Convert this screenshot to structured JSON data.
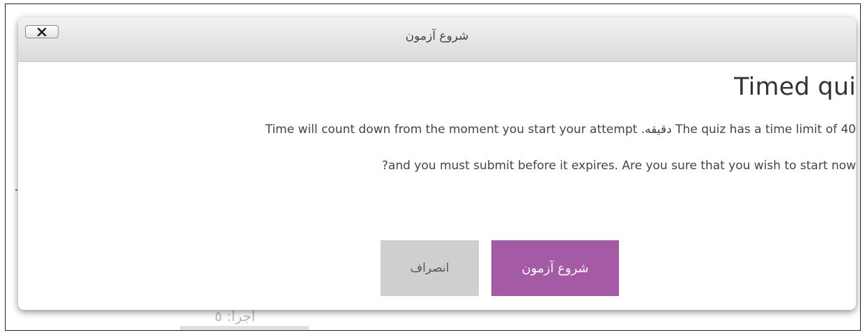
{
  "dialog": {
    "title": "شروع آزمون",
    "close_icon": "close-x-icon",
    "heading": "Timed qui",
    "message_line1": "Time will count down from the moment you start your attempt .دقیقه The quiz has a time limit of 40",
    "message_line2": "?and you must submit before it expires. Are you sure that you wish to start now",
    "start_label": "شروع آزمون",
    "cancel_label": "انصراف"
  },
  "background": {
    "partial_text": "اجرا: ٥"
  },
  "colors": {
    "start_button": "#a55aa6",
    "cancel_button": "#cfcfcf",
    "titlebar": "#e6e6e6"
  }
}
